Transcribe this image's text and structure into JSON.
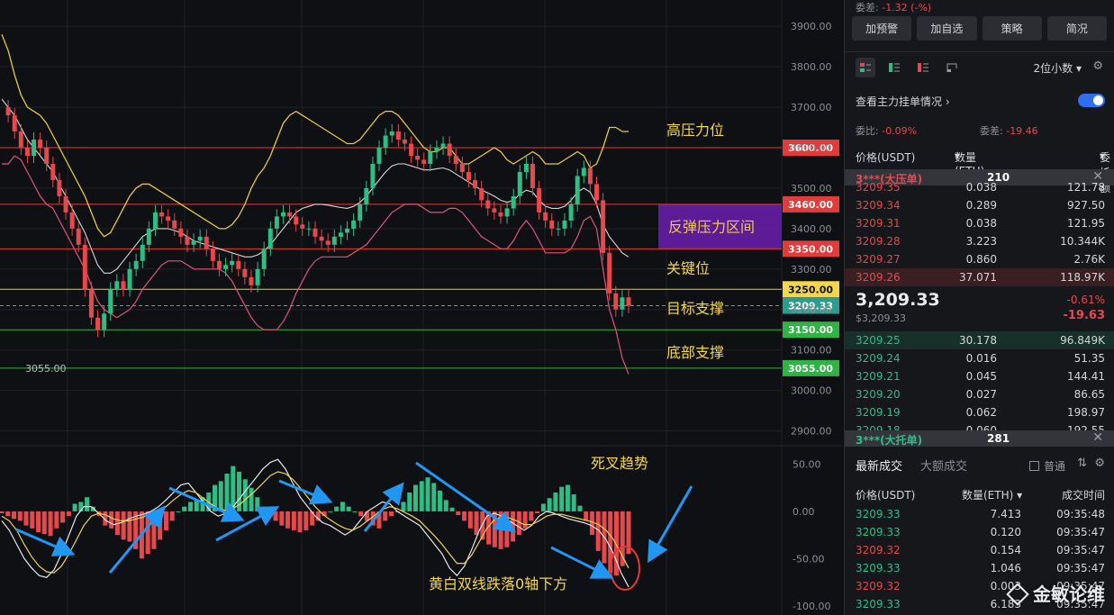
{
  "panel": {
    "top_clip": {
      "label": "委差:",
      "value": "-1.32 (-%)"
    },
    "buttons": [
      "加预警",
      "加自选",
      "策略",
      "简况"
    ],
    "decimals": "2位小数",
    "main_force": "查看主力挂单情况",
    "ratio_label": "委比:",
    "ratio_value": "-0.09%",
    "diff_label": "委差:",
    "diff_value": "-19.46",
    "headers": {
      "price": "价格(USDT)",
      "qty": "数量 (ETH)",
      "amount": "委托额"
    },
    "big_ask": {
      "label": "3***(大压单)",
      "value": "210"
    },
    "asks": [
      {
        "price": "3209.35",
        "qty": "0.038",
        "amt": "121.78"
      },
      {
        "price": "3209.34",
        "qty": "0.289",
        "amt": "927.50"
      },
      {
        "price": "3209.31",
        "qty": "0.038",
        "amt": "121.95"
      },
      {
        "price": "3209.28",
        "qty": "3.223",
        "amt": "10.344K"
      },
      {
        "price": "3209.27",
        "qty": "0.860",
        "amt": "2.76K"
      },
      {
        "price": "3209.26",
        "qty": "37.071",
        "amt": "118.97K"
      }
    ],
    "mid": {
      "price": "3,209.33",
      "usd": "$3,209.33",
      "pct": "-0.61%",
      "change": "-19.63"
    },
    "bids": [
      {
        "price": "3209.25",
        "qty": "30.178",
        "amt": "96.849K"
      },
      {
        "price": "3209.24",
        "qty": "0.016",
        "amt": "51.35"
      },
      {
        "price": "3209.21",
        "qty": "0.045",
        "amt": "144.41"
      },
      {
        "price": "3209.20",
        "qty": "0.027",
        "amt": "86.65"
      },
      {
        "price": "3209.19",
        "qty": "0.062",
        "amt": "198.97"
      },
      {
        "price": "3209.18",
        "qty": "0.060",
        "amt": "192.55"
      }
    ],
    "big_bid": {
      "label": "3***(大托单)",
      "value": "281"
    },
    "tabs": [
      "最新成交",
      "大额成交"
    ],
    "ordinary": "普通",
    "trade_headers": {
      "price": "价格(USDT)",
      "qty": "数量(ETH)",
      "time": "成交时间"
    },
    "trades": [
      {
        "price": "3209.33",
        "qty": "7.413",
        "time": "09:35:48",
        "side": "up"
      },
      {
        "price": "3209.33",
        "qty": "0.120",
        "time": "09:35:47",
        "side": "up"
      },
      {
        "price": "3209.32",
        "qty": "0.154",
        "time": "09:35:47",
        "side": "down"
      },
      {
        "price": "3209.33",
        "qty": "1.046",
        "time": "09:35:47",
        "side": "up"
      },
      {
        "price": "3209.32",
        "qty": "0.003",
        "time": "09:35:47",
        "side": "down"
      },
      {
        "price": "3209.33",
        "qty": "6.183",
        "time": "09:35:47",
        "side": "up"
      }
    ],
    "watermark": "金敏论维"
  },
  "chart_data": [
    {
      "type": "line",
      "title": "",
      "price_ticks": [
        3900,
        3800,
        3700,
        3600,
        3500,
        3400,
        3300,
        3200,
        3100,
        3000,
        2900
      ],
      "price_tick_labels": [
        "3900.00",
        "3800.00",
        "3700.00",
        "3600.00",
        "3500.00",
        "3400.00",
        "3300.00",
        "3200.00",
        "3100.00",
        "3000.00",
        "2900.00"
      ],
      "ylim": [
        2870,
        3965
      ],
      "current_price": {
        "value": 3209.33,
        "label": "3209.33"
      },
      "low_marker": {
        "value": 3055,
        "label": "3055.00"
      },
      "levels": [
        {
          "value": 3600,
          "label": "3600.00",
          "color": "#e23b3b",
          "text": "高压力位"
        },
        {
          "value": 3460,
          "label": "3460.00",
          "color": "#e23b3b",
          "text": ""
        },
        {
          "value": 3350,
          "label": "3350.00",
          "color": "#e23b3b",
          "text": ""
        },
        {
          "value": 3250,
          "label": "3250.00",
          "color": "#e8c93a",
          "text": "关键位"
        },
        {
          "value": 3150,
          "label": "3150.00",
          "color": "#2fb344",
          "text": "目标支撑"
        },
        {
          "value": 3055,
          "label": "3055.00",
          "color": "#2fb344",
          "text": "底部支撑"
        }
      ],
      "zone": {
        "from": 3350,
        "to": 3460,
        "text": "反弹压力区间",
        "color": "#6a1fb0"
      },
      "candle_colors": {
        "up": "#2ebd85",
        "down": "#e5484d"
      },
      "series": [
        {
          "id": "price",
          "values": [
            3700,
            3680,
            3640,
            3600,
            3580,
            3620,
            3600,
            3560,
            3520,
            3480,
            3440,
            3400,
            3360,
            3250,
            3180,
            3150,
            3190,
            3250,
            3270,
            3250,
            3300,
            3320,
            3360,
            3400,
            3440,
            3430,
            3420,
            3400,
            3380,
            3360,
            3370,
            3380,
            3350,
            3320,
            3300,
            3310,
            3320,
            3300,
            3280,
            3260,
            3300,
            3350,
            3400,
            3430,
            3440,
            3430,
            3410,
            3400,
            3400,
            3380,
            3370,
            3360,
            3380,
            3390,
            3400,
            3420,
            3460,
            3500,
            3560,
            3600,
            3630,
            3640,
            3620,
            3610,
            3580,
            3570,
            3560,
            3590,
            3600,
            3610,
            3580,
            3560,
            3540,
            3520,
            3500,
            3470,
            3450,
            3440,
            3430,
            3450,
            3480,
            3540,
            3560,
            3500,
            3440,
            3420,
            3400,
            3400,
            3420,
            3460,
            3530,
            3550,
            3510,
            3470,
            3340,
            3240,
            3200,
            3230,
            3209
          ]
        },
        {
          "id": "upper-band",
          "values": [
            3880,
            3840,
            3780,
            3730,
            3700,
            3690,
            3680,
            3660,
            3630,
            3600,
            3570,
            3540,
            3510,
            3480,
            3440,
            3400,
            3380,
            3390,
            3420,
            3450,
            3480,
            3500,
            3510,
            3510,
            3500,
            3490,
            3480,
            3470,
            3460,
            3450,
            3440,
            3430,
            3420,
            3410,
            3400,
            3400,
            3410,
            3430,
            3460,
            3500,
            3530,
            3550,
            3580,
            3620,
            3660,
            3680,
            3690,
            3680,
            3670,
            3660,
            3650,
            3640,
            3630,
            3620,
            3610,
            3610,
            3620,
            3640,
            3660,
            3680,
            3690,
            3690,
            3680,
            3660,
            3640,
            3620,
            3600,
            3590,
            3590,
            3600,
            3600,
            3580,
            3560,
            3560,
            3570,
            3580,
            3590,
            3600,
            3590,
            3570,
            3560,
            3570,
            3580,
            3590,
            3580,
            3560,
            3560,
            3560,
            3570,
            3580,
            3590,
            3580,
            3550,
            3560,
            3600,
            3650,
            3650,
            3640,
            3640
          ]
        },
        {
          "id": "mid-band",
          "values": [
            3720,
            3700,
            3680,
            3650,
            3620,
            3600,
            3580,
            3560,
            3540,
            3510,
            3480,
            3450,
            3420,
            3390,
            3350,
            3310,
            3290,
            3290,
            3300,
            3320,
            3340,
            3360,
            3380,
            3390,
            3400,
            3400,
            3400,
            3395,
            3390,
            3380,
            3370,
            3365,
            3360,
            3355,
            3350,
            3345,
            3340,
            3335,
            3330,
            3330,
            3335,
            3345,
            3360,
            3380,
            3400,
            3420,
            3440,
            3450,
            3455,
            3460,
            3460,
            3458,
            3455,
            3452,
            3450,
            3455,
            3465,
            3480,
            3500,
            3520,
            3540,
            3555,
            3560,
            3560,
            3555,
            3550,
            3545,
            3545,
            3548,
            3550,
            3545,
            3535,
            3525,
            3515,
            3505,
            3495,
            3488,
            3480,
            3470,
            3465,
            3470,
            3485,
            3495,
            3490,
            3470,
            3455,
            3450,
            3450,
            3455,
            3470,
            3490,
            3500,
            3490,
            3460,
            3410,
            3380,
            3360,
            3340,
            3330
          ]
        },
        {
          "id": "lower-band",
          "values": [
            3560,
            3560,
            3580,
            3570,
            3540,
            3510,
            3480,
            3460,
            3450,
            3420,
            3390,
            3360,
            3330,
            3300,
            3260,
            3220,
            3200,
            3190,
            3180,
            3190,
            3200,
            3220,
            3250,
            3270,
            3290,
            3310,
            3320,
            3320,
            3320,
            3310,
            3300,
            3300,
            3300,
            3300,
            3300,
            3290,
            3270,
            3240,
            3210,
            3180,
            3160,
            3150,
            3150,
            3150,
            3170,
            3200,
            3240,
            3270,
            3300,
            3320,
            3330,
            3330,
            3330,
            3330,
            3330,
            3340,
            3350,
            3360,
            3380,
            3400,
            3420,
            3440,
            3450,
            3460,
            3460,
            3460,
            3450,
            3440,
            3440,
            3440,
            3450,
            3450,
            3440,
            3420,
            3400,
            3380,
            3370,
            3360,
            3350,
            3350,
            3370,
            3400,
            3420,
            3400,
            3370,
            3340,
            3340,
            3340,
            3340,
            3350,
            3380,
            3420,
            3430,
            3400,
            3300,
            3200,
            3150,
            3080,
            3040
          ]
        }
      ]
    },
    {
      "type": "bar",
      "title": "死叉趋势",
      "annotation": "黄白双线跌落0轴下方",
      "yticks": [
        50,
        0,
        -50,
        -100
      ],
      "ytick_labels": [
        "50.00",
        "0.00",
        "-50.00",
        "-100.00"
      ],
      "ylim": [
        -105,
        60
      ],
      "values": [
        -2,
        -5,
        -8,
        -10,
        -15,
        -18,
        -22,
        -24,
        -26,
        -18,
        -12,
        -5,
        8,
        10,
        15,
        5,
        -5,
        -15,
        -18,
        -25,
        -30,
        -32,
        -40,
        -50,
        -45,
        -40,
        -30,
        -20,
        -10,
        0,
        5,
        10,
        12,
        15,
        20,
        28,
        32,
        40,
        48,
        42,
        34,
        25,
        15,
        5,
        -5,
        -10,
        -15,
        -18,
        -20,
        -22,
        -20,
        -15,
        -10,
        -5,
        0,
        5,
        10,
        5,
        0,
        -5,
        -10,
        -15,
        -18,
        -10,
        -5,
        0,
        10,
        20,
        28,
        32,
        36,
        30,
        22,
        12,
        4,
        -4,
        -10,
        -18,
        -25,
        -30,
        -35,
        -38,
        -40,
        -38,
        -32,
        -25,
        -18,
        -10,
        -2,
        8,
        14,
        20,
        26,
        28,
        18,
        6,
        -10,
        -25,
        -42,
        -55,
        -65,
        -68,
        -58,
        -45
      ],
      "series": [
        {
          "id": "dif-white",
          "values": [
            -10,
            -20,
            -35,
            -50,
            -60,
            -68,
            -70,
            -62,
            -45,
            -25,
            -5,
            5,
            5,
            -2,
            -10,
            -14,
            -12,
            -8,
            -5,
            -3,
            0,
            5,
            12,
            20,
            28,
            30,
            20,
            10,
            0,
            -5,
            -2,
            5,
            15,
            25,
            35,
            45,
            52,
            55,
            45,
            30,
            15,
            5,
            -5,
            -12,
            -15,
            -20,
            -25,
            -20,
            -10,
            0,
            5,
            10,
            8,
            0,
            -5,
            -10,
            -15,
            -25,
            -35,
            -45,
            -60,
            -68,
            -58,
            -40,
            -20,
            -5,
            -2,
            -5,
            -10,
            -15,
            -20,
            -15,
            -5,
            0,
            -2,
            -5,
            -8,
            -10,
            -12,
            -15,
            -20,
            -30,
            -45,
            -65,
            -80
          ]
        },
        {
          "id": "dea-yellow",
          "values": [
            -5,
            -10,
            -20,
            -35,
            -48,
            -58,
            -64,
            -65,
            -58,
            -45,
            -30,
            -15,
            -5,
            -2,
            -4,
            -8,
            -10,
            -10,
            -8,
            -6,
            -3,
            0,
            5,
            12,
            18,
            22,
            20,
            14,
            8,
            3,
            1,
            3,
            8,
            15,
            22,
            30,
            38,
            42,
            40,
            34,
            25,
            15,
            5,
            -3,
            -9,
            -14,
            -18,
            -20,
            -16,
            -10,
            -4,
            2,
            5,
            3,
            -1,
            -5,
            -10,
            -18,
            -26,
            -35,
            -45,
            -55,
            -55,
            -46,
            -32,
            -18,
            -9,
            -6,
            -7,
            -10,
            -14,
            -14,
            -10,
            -5,
            -3,
            -3,
            -5,
            -7,
            -9,
            -11,
            -14,
            -20,
            -30,
            -45,
            -60
          ]
        }
      ]
    }
  ]
}
